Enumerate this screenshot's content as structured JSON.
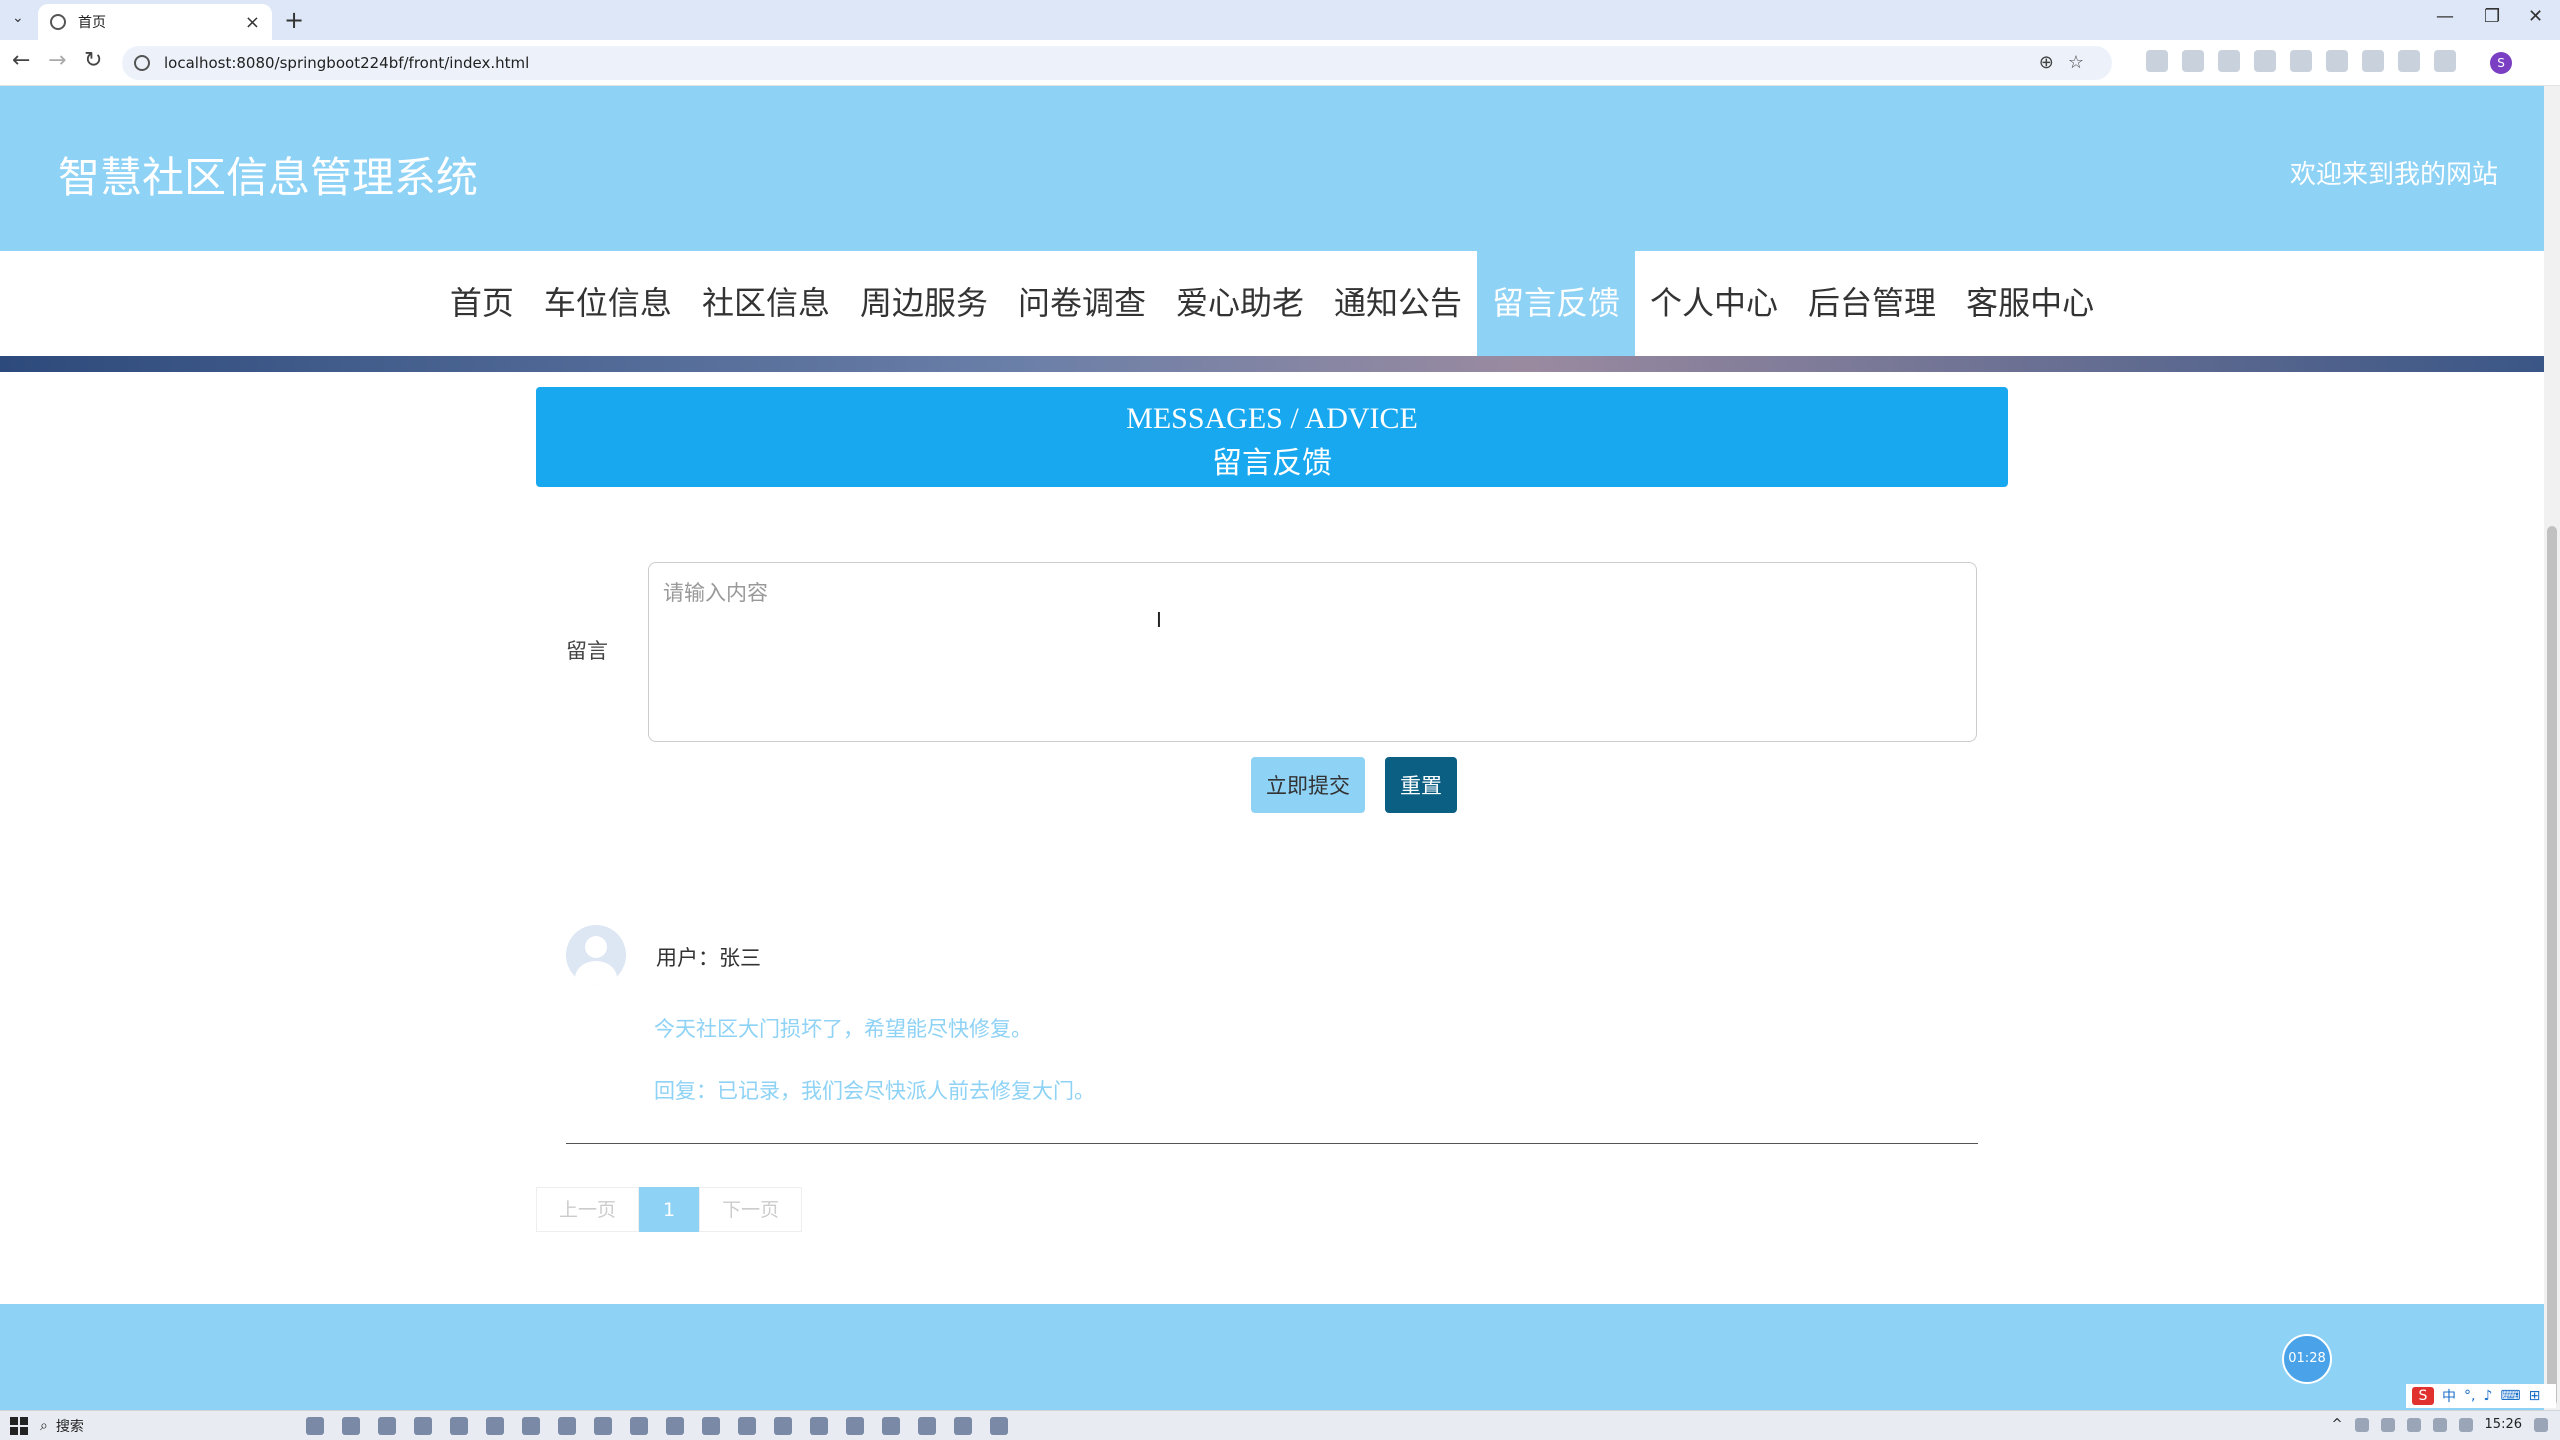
{
  "browser": {
    "tab_title": "首页",
    "url": "localhost:8080/springboot224bf/front/index.html"
  },
  "site": {
    "title": "智慧社区信息管理系统",
    "welcome": "欢迎来到我的网站"
  },
  "nav": {
    "items": [
      "首页",
      "车位信息",
      "社区信息",
      "周边服务",
      "问卷调查",
      "爱心助老",
      "通知公告",
      "留言反馈",
      "个人中心",
      "后台管理",
      "客服中心"
    ],
    "active": "留言反馈"
  },
  "section": {
    "title_en": "MESSAGES / ADVICE",
    "title_cn": "留言反馈"
  },
  "form": {
    "label": "留言",
    "placeholder": "请输入内容",
    "value": "",
    "submit_label": "立即提交",
    "reset_label": "重置"
  },
  "comments": [
    {
      "user": "用户：张三",
      "content": "今天社区大门损坏了，希望能尽快修复。",
      "reply": "回复：已记录，我们会尽快派人前去修复大门。"
    }
  ],
  "pagination": {
    "prev": "上一页",
    "current": "1",
    "next": "下一页"
  },
  "timer": "01:28",
  "taskbar": {
    "search": "搜索",
    "time": "15:26",
    "ime_lang": "中"
  },
  "colors": {
    "primary": "#8ed2f5",
    "section_head": "#17a8ef",
    "reset_button": "#0b5f82"
  }
}
